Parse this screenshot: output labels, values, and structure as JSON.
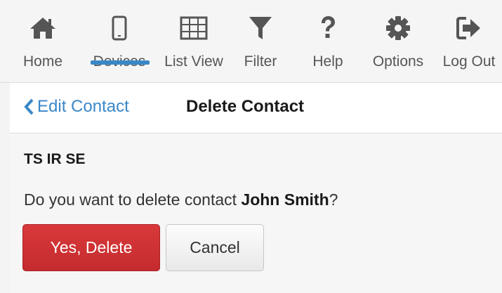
{
  "toolbar": {
    "items": [
      {
        "label": "Home",
        "icon": "home-icon"
      },
      {
        "label": "Devices",
        "icon": "mobile-device-icon",
        "active": true
      },
      {
        "label": "List View",
        "icon": "grid-icon"
      },
      {
        "label": "Filter",
        "icon": "funnel-icon"
      },
      {
        "label": "Help",
        "icon": "question-mark-icon"
      },
      {
        "label": "Options",
        "icon": "gear-icon"
      },
      {
        "label": "Log Out",
        "icon": "logout-icon"
      }
    ]
  },
  "nav": {
    "back_label": "Edit Contact",
    "back_icon": "chevron-left-icon",
    "title": "Delete Contact"
  },
  "content": {
    "device_name": "TS IR SE",
    "question_prefix": "Do you want to delete contact ",
    "contact_name": "John Smith",
    "question_suffix": "?"
  },
  "buttons": {
    "confirm_label": "Yes, Delete",
    "cancel_label": "Cancel"
  },
  "colors": {
    "icon": "#555555",
    "accent": "#3a87c8",
    "danger": "#cb3235"
  }
}
